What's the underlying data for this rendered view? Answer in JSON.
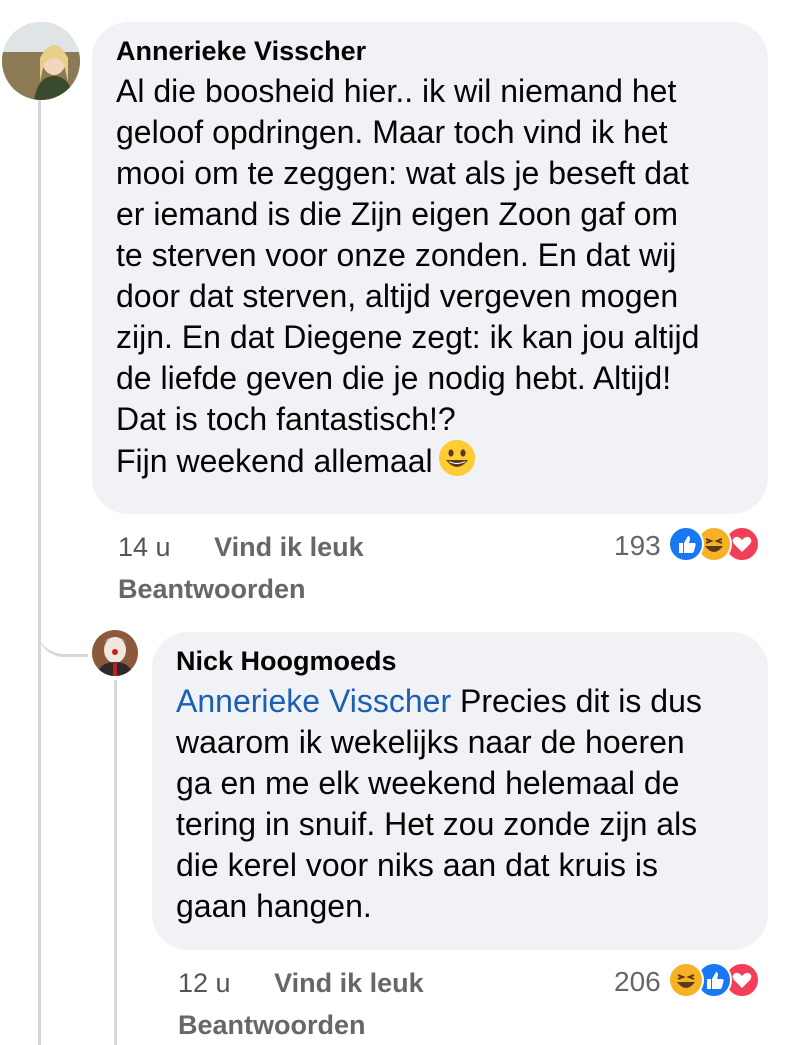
{
  "colors": {
    "bubble_bg": "#f0f2f5",
    "mention": "#1b5fb5",
    "like_blue": "#1877f2",
    "love_red": "#f33e58",
    "haha_yellow": "#f7b125"
  },
  "comments": [
    {
      "author": "Annerieke Visscher",
      "text": "Al die boosheid hier.. ik wil niemand het\ngeloof opdringen. Maar toch vind ik het\nmooi om te zeggen: wat als je beseft dat\ner iemand is die Zijn eigen Zoon gaf om\nte sterven voor onze zonden. En dat wij\ndoor dat sterven, altijd vergeven mogen\nzijn. En dat Diegene zegt: ik kan jou altijd\nde liefde geven die je nodig hebt. Altijd!\nDat is toch fantastisch!?\nFijn weekend allemaal",
      "emoji": "grinning-face-emoji",
      "time": "14 u",
      "like_label": "Vind ik leuk",
      "reply_label": "Beantwoorden",
      "reaction_count": "193",
      "reactions": [
        "like-icon",
        "haha-icon",
        "love-icon"
      ]
    },
    {
      "author": "Nick Hoogmoeds",
      "mention": "Annerieke Visscher",
      "text": " Precies dit is dus\nwaarom ik wekelijks naar de hoeren\nga en me elk weekend helemaal de\ntering in snuif. Het zou zonde zijn als\ndie kerel voor niks aan dat kruis is\ngaan hangen.",
      "time": "12 u",
      "like_label": "Vind ik leuk",
      "reply_label": "Beantwoorden",
      "reaction_count": "206",
      "reactions": [
        "haha-icon",
        "like-icon",
        "love-icon"
      ]
    }
  ]
}
